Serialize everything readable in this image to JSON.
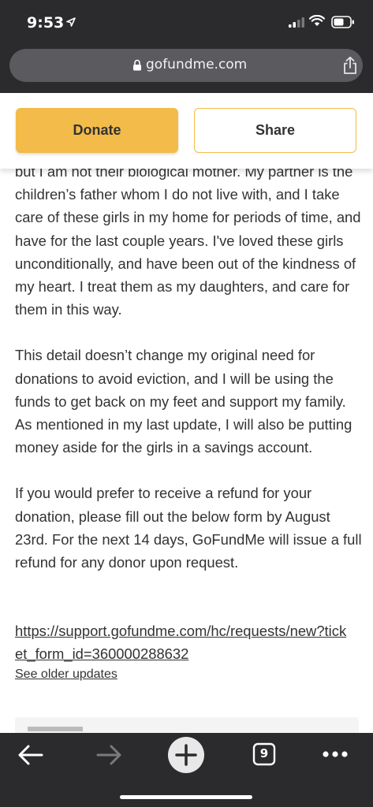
{
  "status_bar": {
    "time": "9:53"
  },
  "browser": {
    "url": "gofundme.com"
  },
  "actions": {
    "donate_label": "Donate",
    "share_label": "Share"
  },
  "update": {
    "paragraph1": "but I am not their biological mother. My partner is the children’s father whom I do not live with, and I take care of these girls in my home for periods of time, and have for the last couple years. I've loved these girls unconditionally, and have been out of the kindness of my heart. I treat them as my daughters, and care for them in this way.",
    "paragraph2": "This detail doesn’t change my original need for donations to avoid eviction, and I will be using the funds to get back on my feet and support my family. As mentioned in my last update, I will also be putting money aside for the girls in a savings account.",
    "paragraph3": "If you would prefer to receive a refund for your donation, please fill out the below form by August 23rd. For the next 14 days, GoFundMe will issue a full refund for any donor upon request.",
    "refund_link": "https://support.gofundme.com/hc/requests/new?ticket_form_id=360000288632",
    "older_updates_label": "See older updates"
  },
  "toolbar": {
    "tab_count": "9"
  },
  "colors": {
    "accent": "#f3bb4a",
    "chrome": "#2b2b2d",
    "text": "#333333"
  },
  "icons": [
    "location-arrow-icon",
    "signal-icon",
    "wifi-icon",
    "battery-icon",
    "lock-icon",
    "share-icon",
    "back-arrow-icon",
    "forward-arrow-icon",
    "plus-icon",
    "tabs-icon",
    "more-icon"
  ]
}
